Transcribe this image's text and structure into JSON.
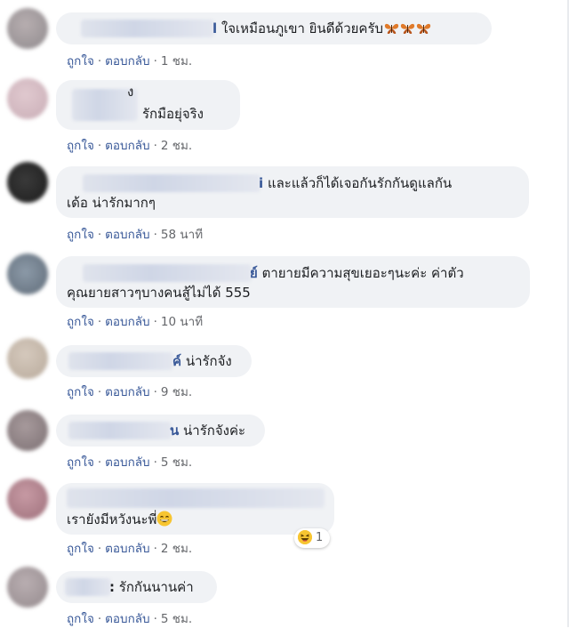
{
  "colors": {
    "bubble_bg": "#f0f2f5",
    "link": "#385898",
    "meta": "#65676b",
    "text": "#1c1e21"
  },
  "actions": {
    "like": "ถูกใจ",
    "reply": "ตอบกลับ",
    "sep": "·"
  },
  "comments": [
    {
      "name_tail": "l",
      "lines": [
        "ใจเหมือนภูเขา ยินดีด้วยครับ"
      ],
      "time": "1 ชม.",
      "emoji_icons": [
        "butterfly-icon",
        "butterfly-icon",
        "butterfly-icon"
      ]
    },
    {
      "name_tail": "ง",
      "lines": [
        "รักมือยุ่จริง"
      ],
      "time": "2 ชม."
    },
    {
      "name_tail": "i",
      "lines": [
        "และแล้วก็ได้เจอกันรักกันดูแลกัน",
        "เด้อ น่ารักมากๆ"
      ],
      "time": "58 นาที"
    },
    {
      "name_tail": "ย์",
      "lines": [
        "ตายายมีความสุขเยอะๆนะค่ะ ค่าตัว",
        "คุณยายสาวๆบางคนสู้ไม่ได้ 555"
      ],
      "time": "10 นาที"
    },
    {
      "name_tail": "ค์",
      "lines": [
        "น่ารักจัง"
      ],
      "time": "9 ชม."
    },
    {
      "name_tail": "น",
      "lines": [
        "น่ารักจังค่ะ"
      ],
      "time": "5 ชม."
    },
    {
      "name_tail": "",
      "lines": [
        "เรายังมีหวังนะพี่"
      ],
      "time": "2 ชม.",
      "emoji_icons": [
        "grinning-face-icon"
      ],
      "reaction": {
        "icon": "laughing-face-icon",
        "count": "1"
      }
    },
    {
      "name_tail": ":",
      "lines": [
        "รักกันนานค่า"
      ],
      "time": "5 ชม."
    }
  ]
}
